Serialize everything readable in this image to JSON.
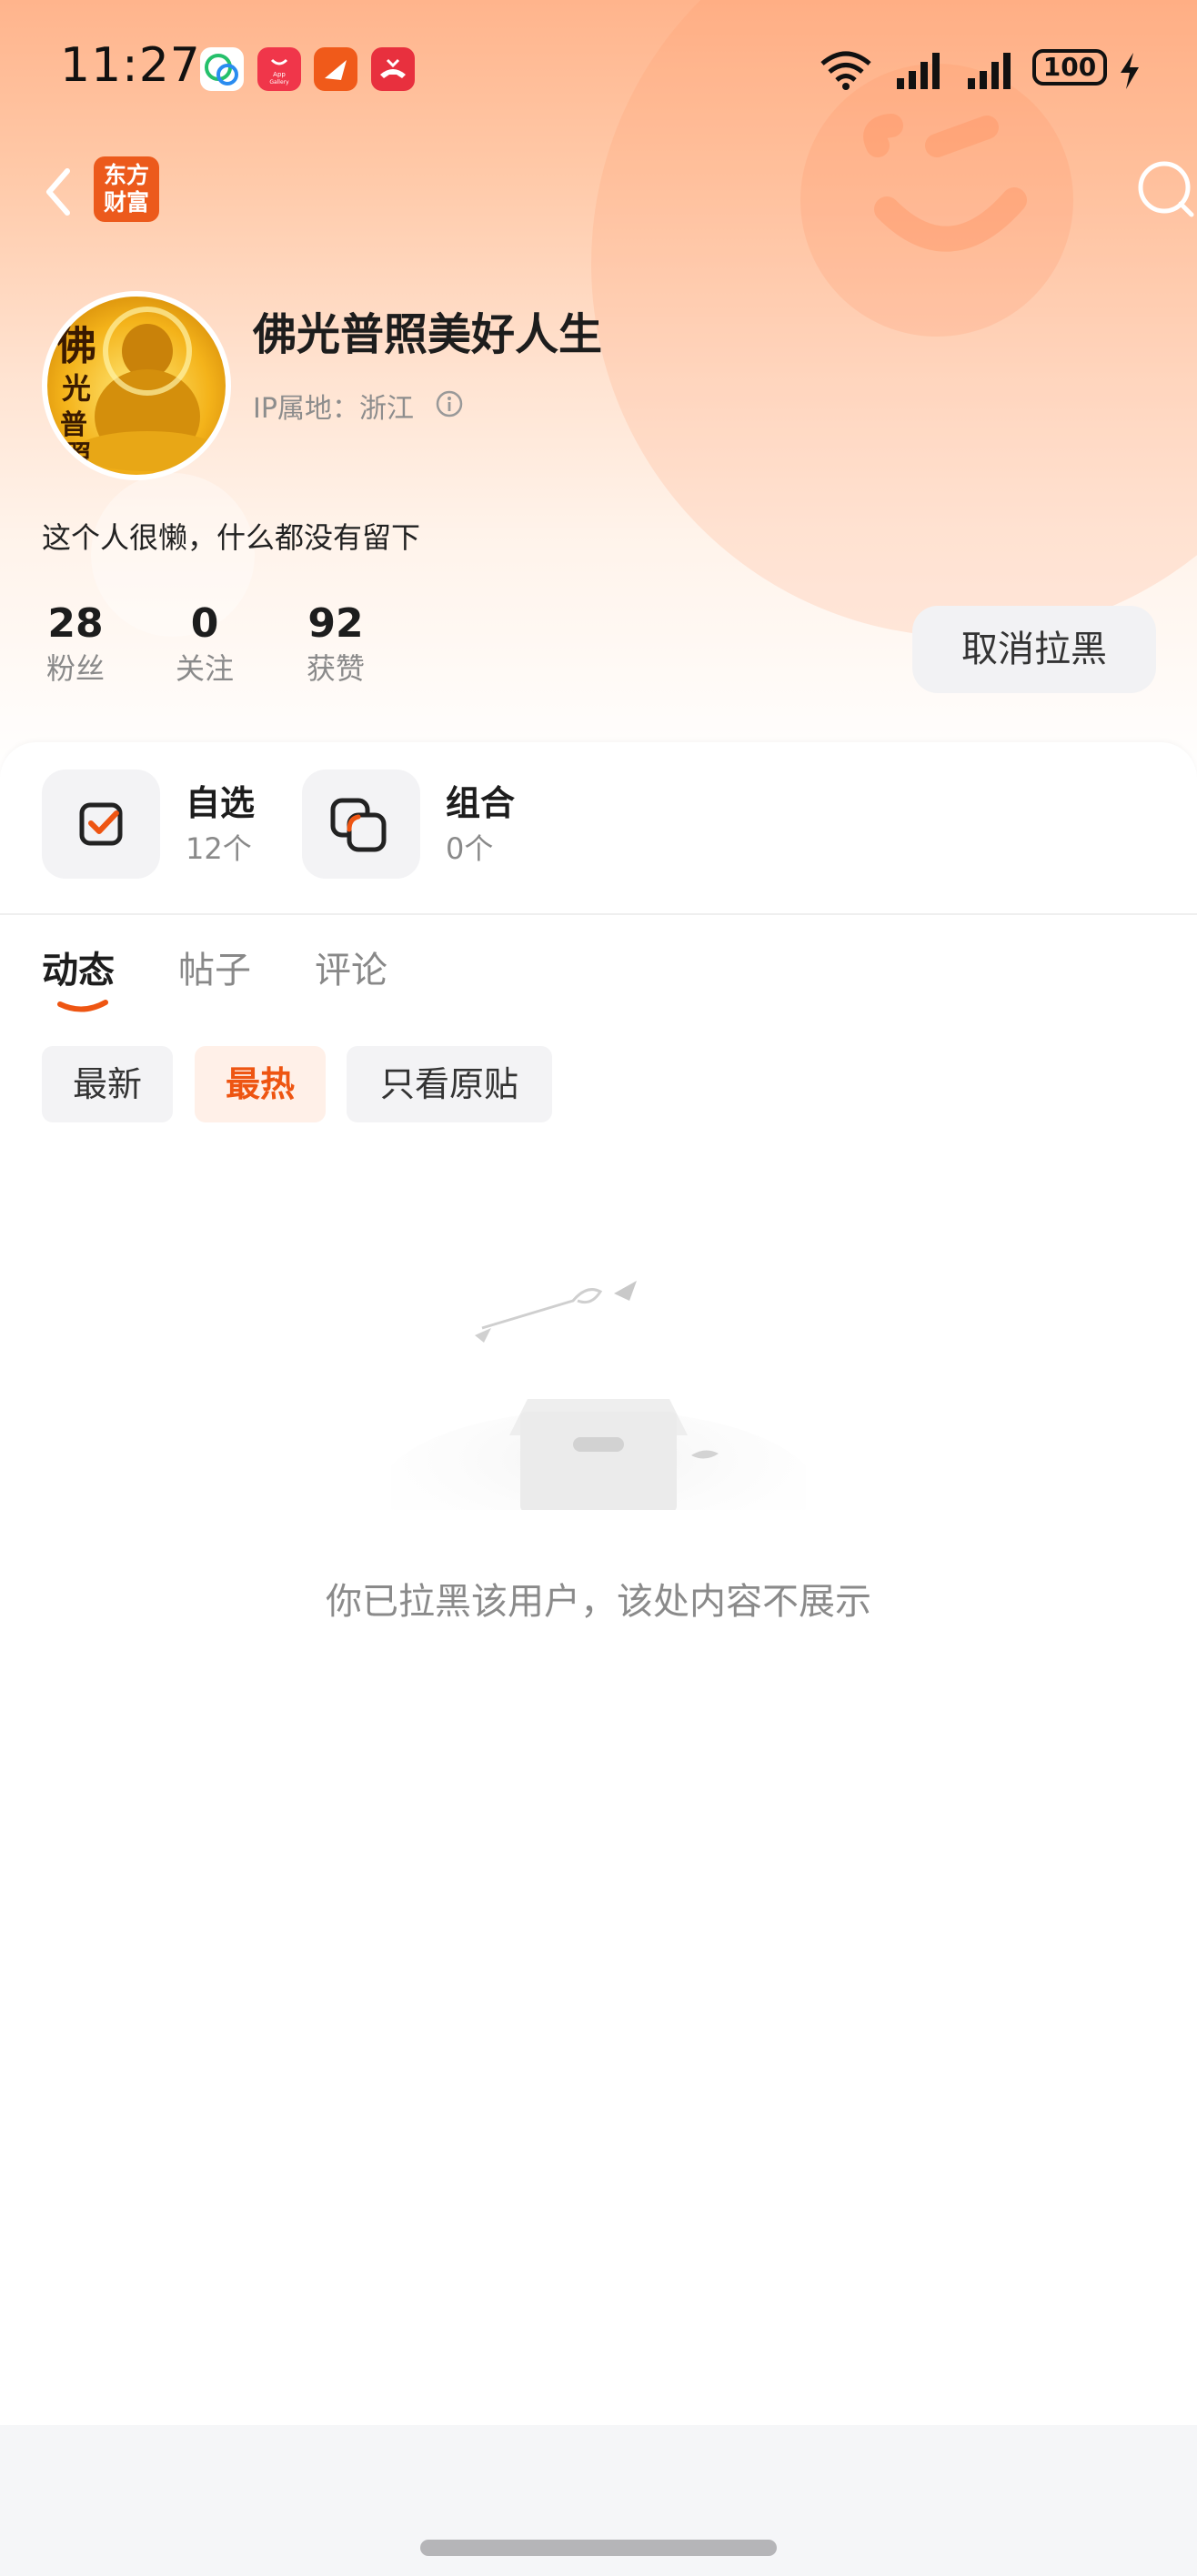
{
  "status_bar": {
    "time": "11:27",
    "battery": "100",
    "notification_icons": [
      "wechat-icon",
      "app-gallery-icon",
      "feishu-icon",
      "missed-call-icon"
    ],
    "notification_app_gallery_text": "App Gallery"
  },
  "nav": {
    "logo_line1": "东方",
    "logo_line2": "财富",
    "back_icon": "chevron-left-icon",
    "search_icon": "search-icon"
  },
  "profile": {
    "username": "佛光普照美好人生",
    "ip_location": "IP属地：浙江",
    "bio": "这个人很懒，什么都没有留下",
    "avatar_text": [
      "佛",
      "光",
      "普",
      "照"
    ],
    "stats": [
      {
        "value": "28",
        "label": "粉丝"
      },
      {
        "value": "0",
        "label": "关注"
      },
      {
        "value": "92",
        "label": "获赞"
      }
    ],
    "unblock_label": "取消拉黑"
  },
  "cards": {
    "watchlist": {
      "title": "自选",
      "count": "12个"
    },
    "portfolio": {
      "title": "组合",
      "count": "0个"
    }
  },
  "tabs": [
    {
      "label": "动态",
      "active": true
    },
    {
      "label": "帖子",
      "active": false
    },
    {
      "label": "评论",
      "active": false
    }
  ],
  "filters": [
    {
      "label": "最新",
      "active": false
    },
    {
      "label": "最热",
      "active": true
    },
    {
      "label": "只看原贴",
      "active": false
    }
  ],
  "empty_state": {
    "message": "你已拉黑该用户，该处内容不展示"
  },
  "colors": {
    "accent": "#ee5512",
    "header_gradient_top": "#ffb48c",
    "text_primary": "#1d1d1d",
    "text_secondary": "#8a8a8a"
  }
}
